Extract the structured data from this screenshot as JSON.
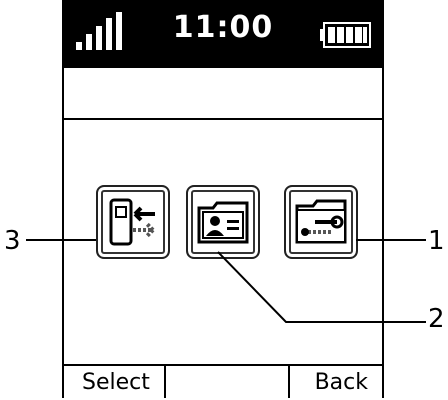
{
  "status_bar": {
    "time": "11:00",
    "signal_icon": "signal-strength-icon",
    "battery_icon": "battery-full-icon"
  },
  "menu_icons": [
    {
      "icon": "data-transfer-icon"
    },
    {
      "icon": "contact-card-folder-icon"
    },
    {
      "icon": "settings-folder-icon"
    }
  ],
  "softkeys": {
    "left_label": "Select",
    "right_label": "Back"
  },
  "callouts": {
    "one": "1",
    "two": "2",
    "three": "3"
  }
}
